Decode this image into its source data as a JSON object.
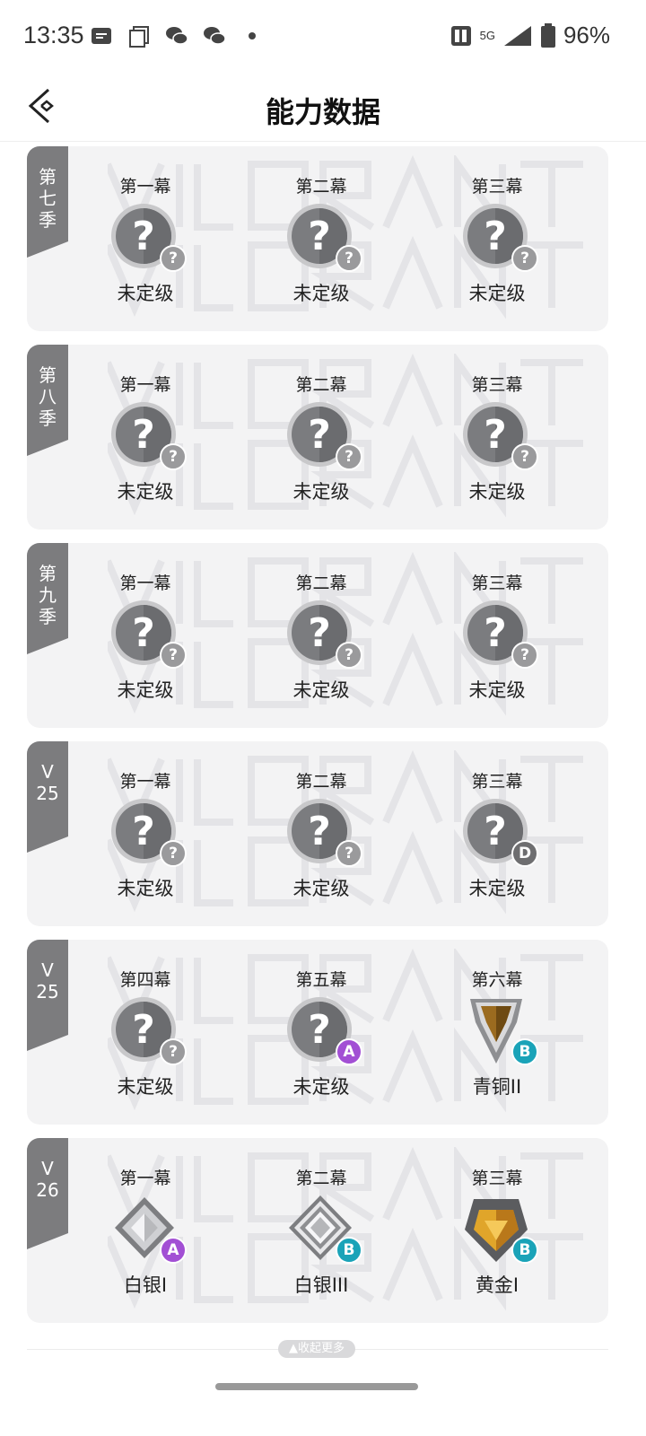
{
  "status_bar": {
    "time": "13:35",
    "network": "5G",
    "battery": "96%"
  },
  "header": {
    "title": "能力数据"
  },
  "seasons": [
    {
      "label": [
        "第",
        "七",
        "季"
      ],
      "acts": [
        {
          "name": "第一幕",
          "rank": "未定级",
          "badge": "unrated",
          "grade": "?"
        },
        {
          "name": "第二幕",
          "rank": "未定级",
          "badge": "unrated",
          "grade": "?"
        },
        {
          "name": "第三幕",
          "rank": "未定级",
          "badge": "unrated",
          "grade": "?"
        }
      ]
    },
    {
      "label": [
        "第",
        "八",
        "季"
      ],
      "acts": [
        {
          "name": "第一幕",
          "rank": "未定级",
          "badge": "unrated",
          "grade": "?"
        },
        {
          "name": "第二幕",
          "rank": "未定级",
          "badge": "unrated",
          "grade": "?"
        },
        {
          "name": "第三幕",
          "rank": "未定级",
          "badge": "unrated",
          "grade": "?"
        }
      ]
    },
    {
      "label": [
        "第",
        "九",
        "季"
      ],
      "acts": [
        {
          "name": "第一幕",
          "rank": "未定级",
          "badge": "unrated",
          "grade": "?"
        },
        {
          "name": "第二幕",
          "rank": "未定级",
          "badge": "unrated",
          "grade": "?"
        },
        {
          "name": "第三幕",
          "rank": "未定级",
          "badge": "unrated",
          "grade": "?"
        }
      ]
    },
    {
      "label": [
        "V",
        "25"
      ],
      "acts": [
        {
          "name": "第一幕",
          "rank": "未定级",
          "badge": "unrated",
          "grade": "?"
        },
        {
          "name": "第二幕",
          "rank": "未定级",
          "badge": "unrated",
          "grade": "?"
        },
        {
          "name": "第三幕",
          "rank": "未定级",
          "badge": "unrated",
          "grade": "D"
        }
      ]
    },
    {
      "label": [
        "V",
        "25"
      ],
      "acts": [
        {
          "name": "第四幕",
          "rank": "未定级",
          "badge": "unrated",
          "grade": "?"
        },
        {
          "name": "第五幕",
          "rank": "未定级",
          "badge": "unrated",
          "grade": "A"
        },
        {
          "name": "第六幕",
          "rank": "青铜II",
          "badge": "bronze",
          "grade": "B"
        }
      ]
    },
    {
      "label": [
        "V",
        "26"
      ],
      "acts": [
        {
          "name": "第一幕",
          "rank": "白银I",
          "badge": "silver1",
          "grade": "A"
        },
        {
          "name": "第二幕",
          "rank": "白银III",
          "badge": "silver3",
          "grade": "B"
        },
        {
          "name": "第三幕",
          "rank": "黄金I",
          "badge": "gold",
          "grade": "B"
        }
      ]
    }
  ],
  "footer": {
    "collapse_label": "▲收起更多"
  },
  "colors": {
    "card_bg": "#f3f3f4",
    "tag_bg": "#7c7c7e",
    "grade_A": "#a24fd4",
    "grade_B": "#1aa3b8",
    "grade_D": "#6e6e70",
    "grade_unknown": "#9a9a9c"
  }
}
